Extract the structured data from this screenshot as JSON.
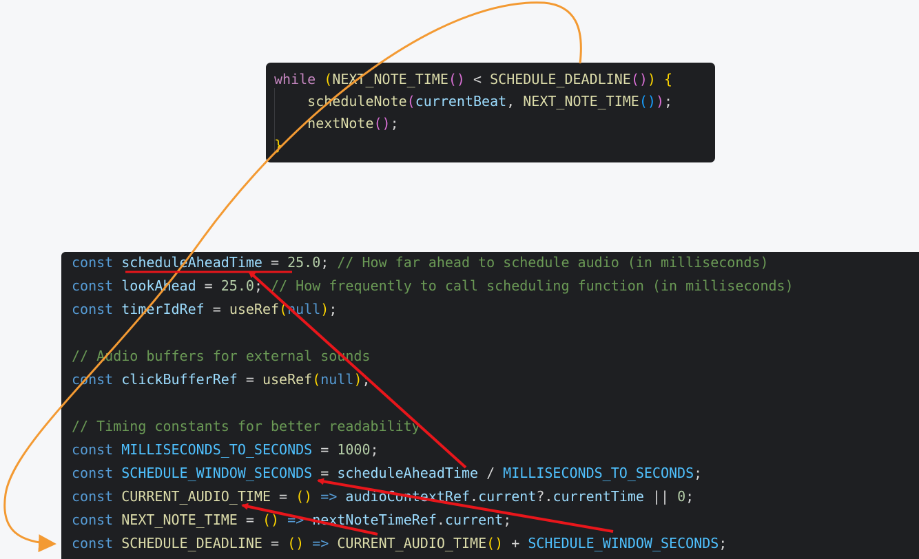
{
  "top_block": {
    "lines": [
      [
        [
          "ctl",
          "while"
        ],
        [
          "op",
          " "
        ],
        [
          "p1",
          "("
        ],
        [
          "fn",
          "NEXT_NOTE_TIME"
        ],
        [
          "p2",
          "()"
        ],
        [
          "op",
          " < "
        ],
        [
          "fn",
          "SCHEDULE_DEADLINE"
        ],
        [
          "p2",
          "()"
        ],
        [
          "p1",
          ")"
        ],
        [
          "op",
          " "
        ],
        [
          "p1",
          "{"
        ]
      ],
      [
        [
          "op",
          "    "
        ],
        [
          "fn",
          "scheduleNote"
        ],
        [
          "p2",
          "("
        ],
        [
          "var",
          "currentBeat"
        ],
        [
          "op",
          ", "
        ],
        [
          "fn",
          "NEXT_NOTE_TIME"
        ],
        [
          "p3",
          "()"
        ],
        [
          "p2",
          ")"
        ],
        [
          "op",
          ";"
        ]
      ],
      [
        [
          "op",
          "    "
        ],
        [
          "fn",
          "nextNote"
        ],
        [
          "p2",
          "()"
        ],
        [
          "op",
          ";"
        ]
      ],
      [
        [
          "p1",
          "}"
        ]
      ]
    ]
  },
  "bottom_block": {
    "lines": [
      [
        [
          "kw",
          "const"
        ],
        [
          "op",
          " "
        ],
        [
          "var",
          "scheduleAheadTime"
        ],
        [
          "op",
          " = "
        ],
        [
          "num",
          "25.0"
        ],
        [
          "op",
          "; "
        ],
        [
          "cmt",
          "// How far ahead to schedule audio (in milliseconds)"
        ]
      ],
      [
        [
          "kw",
          "const"
        ],
        [
          "op",
          " "
        ],
        [
          "var",
          "lookAhead"
        ],
        [
          "op",
          " = "
        ],
        [
          "num",
          "25.0"
        ],
        [
          "op",
          "; "
        ],
        [
          "cmt",
          "// How frequently to call scheduling function (in milliseconds)"
        ]
      ],
      [
        [
          "kw",
          "const"
        ],
        [
          "op",
          " "
        ],
        [
          "var",
          "timerIdRef"
        ],
        [
          "op",
          " = "
        ],
        [
          "fn",
          "useRef"
        ],
        [
          "p1",
          "("
        ],
        [
          "kw",
          "null"
        ],
        [
          "p1",
          ")"
        ],
        [
          "op",
          ";"
        ]
      ],
      [],
      [
        [
          "cmt",
          "// Audio buffers for external sounds"
        ]
      ],
      [
        [
          "kw",
          "const"
        ],
        [
          "op",
          " "
        ],
        [
          "var",
          "clickBufferRef"
        ],
        [
          "op",
          " = "
        ],
        [
          "fn",
          "useRef"
        ],
        [
          "p1",
          "("
        ],
        [
          "kw",
          "null"
        ],
        [
          "p1",
          ")"
        ],
        [
          "op",
          ";"
        ]
      ],
      [],
      [
        [
          "cmt",
          "// Timing constants for better readability"
        ]
      ],
      [
        [
          "kw",
          "const"
        ],
        [
          "op",
          " "
        ],
        [
          "const",
          "MILLISECONDS_TO_SECONDS"
        ],
        [
          "op",
          " = "
        ],
        [
          "num",
          "1000"
        ],
        [
          "op",
          ";"
        ]
      ],
      [
        [
          "kw",
          "const"
        ],
        [
          "op",
          " "
        ],
        [
          "const",
          "SCHEDULE_WINDOW_SECONDS"
        ],
        [
          "op",
          " = "
        ],
        [
          "var",
          "scheduleAheadTime"
        ],
        [
          "op",
          " / "
        ],
        [
          "const",
          "MILLISECONDS_TO_SECONDS"
        ],
        [
          "op",
          ";"
        ]
      ],
      [
        [
          "kw",
          "const"
        ],
        [
          "op",
          " "
        ],
        [
          "fn",
          "CURRENT_AUDIO_TIME"
        ],
        [
          "op",
          " = "
        ],
        [
          "p1",
          "()"
        ],
        [
          "op",
          " "
        ],
        [
          "kw",
          "=>"
        ],
        [
          "op",
          " "
        ],
        [
          "var",
          "audioContextRef"
        ],
        [
          "op",
          "."
        ],
        [
          "var",
          "current"
        ],
        [
          "op",
          "?."
        ],
        [
          "var",
          "currentTime"
        ],
        [
          "op",
          " || "
        ],
        [
          "num",
          "0"
        ],
        [
          "op",
          ";"
        ]
      ],
      [
        [
          "kw",
          "const"
        ],
        [
          "op",
          " "
        ],
        [
          "fn",
          "NEXT_NOTE_TIME"
        ],
        [
          "op",
          " = "
        ],
        [
          "p1",
          "()"
        ],
        [
          "op",
          " "
        ],
        [
          "kw",
          "=>"
        ],
        [
          "op",
          " "
        ],
        [
          "var",
          "nextNoteTimeRef"
        ],
        [
          "op",
          "."
        ],
        [
          "var",
          "current"
        ],
        [
          "op",
          ";"
        ]
      ],
      [
        [
          "kw",
          "const"
        ],
        [
          "op",
          " "
        ],
        [
          "fn",
          "SCHEDULE_DEADLINE"
        ],
        [
          "op",
          " = "
        ],
        [
          "p1",
          "()"
        ],
        [
          "op",
          " "
        ],
        [
          "kw",
          "=>"
        ],
        [
          "op",
          " "
        ],
        [
          "fn",
          "CURRENT_AUDIO_TIME"
        ],
        [
          "p1",
          "()"
        ],
        [
          "op",
          " + "
        ],
        [
          "const",
          "SCHEDULE_WINDOW_SECONDS"
        ],
        [
          "op",
          ";"
        ]
      ]
    ]
  },
  "annotations": {
    "arrow_color": "#e8161b",
    "loop_arrow_color": "#f39a33",
    "underline_color": "#e8161b"
  }
}
